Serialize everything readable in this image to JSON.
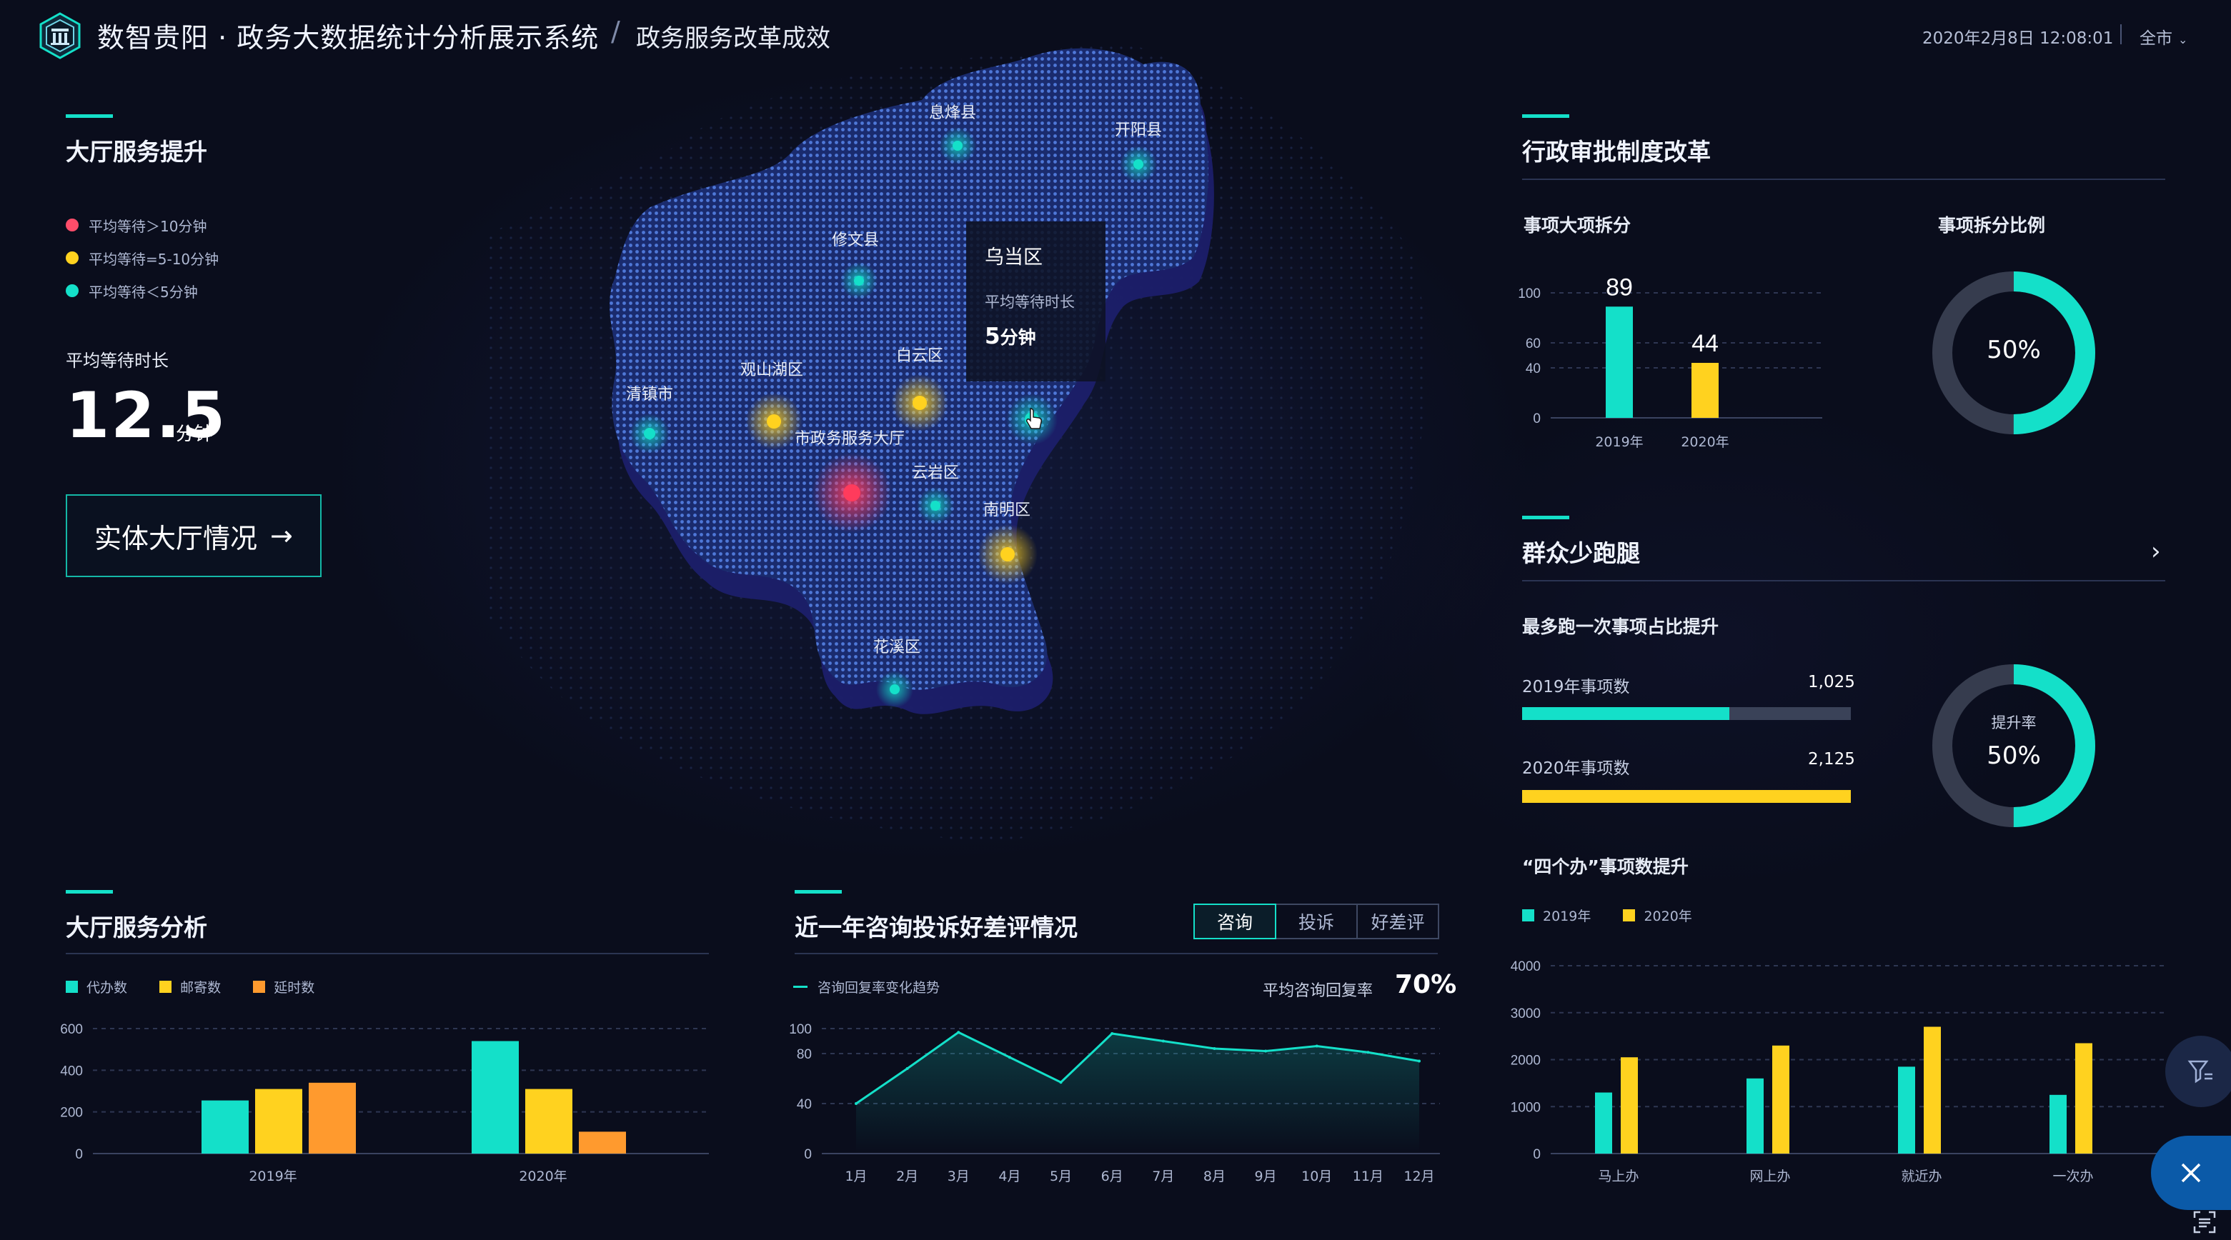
{
  "header": {
    "app_title": "数智贵阳 · 政务大数据统计分析展示系统",
    "separator": "/",
    "page_name": "政务服务改革成效",
    "datetime": "2020年2月8日  12:08:01",
    "city": "全市",
    "logo_icon": "building-shield-icon"
  },
  "hall_service": {
    "title": "大厅服务提升",
    "legend": [
      {
        "label": "平均等待＞10分钟",
        "color": "#ff4d6a"
      },
      {
        "label": "平均等待=5-10分钟",
        "color": "#ffd21f"
      },
      {
        "label": "平均等待＜5分钟",
        "color": "#14e0c9"
      }
    ],
    "avg_wait_label": "平均等待时长",
    "avg_wait_value": "12.5",
    "avg_wait_unit": "分钟",
    "button_label": "实体大厅情况",
    "button_arrow": "→"
  },
  "map": {
    "districts": [
      {
        "name": "息烽县",
        "level": "low"
      },
      {
        "name": "开阳县",
        "level": "low"
      },
      {
        "name": "修文县",
        "level": "low"
      },
      {
        "name": "白云区",
        "level": "mid"
      },
      {
        "name": "观山湖区",
        "level": "mid"
      },
      {
        "name": "清镇市",
        "level": "low"
      },
      {
        "name": "市政务服务大厅",
        "level": "high"
      },
      {
        "name": "云岩区",
        "level": "low"
      },
      {
        "name": "南明区",
        "level": "mid"
      },
      {
        "name": "花溪区",
        "level": "low"
      },
      {
        "name": "乌当区",
        "level": "low"
      }
    ],
    "tooltip": {
      "name": "乌当区",
      "label": "平均等待时长",
      "value": "5",
      "unit": "分钟"
    }
  },
  "admin_reform": {
    "title": "行政审批制度改革",
    "split_title": "事项大项拆分",
    "ratio_title": "事项拆分比例",
    "ratio_value": "50%",
    "ratio_fraction": 0.5,
    "chart_data": {
      "type": "bar",
      "categories": [
        "2019年",
        "2020年"
      ],
      "values": [
        89,
        44
      ],
      "yticks": [
        0,
        40,
        60,
        100
      ],
      "ylim": [
        0,
        100
      ],
      "colors": [
        "#14e0c9",
        "#ffd21f"
      ]
    }
  },
  "less_running": {
    "title": "群众少跑腿",
    "subtitle": "最多跑一次事项占比提升",
    "rows": [
      {
        "label": "2019年事项数",
        "value": "1,025",
        "fraction": 0.63,
        "color": "#14e0c9"
      },
      {
        "label": "2020年事项数",
        "value": "2,125",
        "fraction": 1.0,
        "color": "#ffd21f"
      }
    ],
    "rate_label": "提升率",
    "rate_value": "50%",
    "rate_fraction": 0.5
  },
  "four_bans": {
    "title": "“四个办”事项数提升",
    "legend": [
      {
        "label": "2019年",
        "color": "#14e0c9"
      },
      {
        "label": "2020年",
        "color": "#ffd21f"
      }
    ],
    "chart_data": {
      "type": "bar",
      "categories": [
        "马上办",
        "网上办",
        "就近办",
        "一次办"
      ],
      "series": [
        {
          "name": "2019年",
          "values": [
            1300,
            1600,
            1850,
            1250
          ]
        },
        {
          "name": "2020年",
          "values": [
            2050,
            2300,
            2700,
            2350
          ]
        }
      ],
      "yticks": [
        0,
        1000,
        2000,
        3000,
        4000
      ],
      "ylim": [
        0,
        4000
      ]
    }
  },
  "hall_analysis": {
    "title": "大厅服务分析",
    "legend": [
      {
        "label": "代办数",
        "color": "#14e0c9"
      },
      {
        "label": "邮寄数",
        "color": "#ffd21f"
      },
      {
        "label": "延时数",
        "color": "#ff9a2e"
      }
    ],
    "chart_data": {
      "type": "bar",
      "categories": [
        "2019年",
        "2020年"
      ],
      "series": [
        {
          "name": "代办数",
          "values": [
            255,
            540
          ]
        },
        {
          "name": "邮寄数",
          "values": [
            310,
            310
          ]
        },
        {
          "name": "延时数",
          "values": [
            340,
            105
          ]
        }
      ],
      "yticks": [
        0,
        200,
        400,
        600
      ],
      "ylim": [
        0,
        600
      ]
    }
  },
  "consult": {
    "title": "近一年咨询投诉好差评情况",
    "tabs": [
      {
        "label": "咨询",
        "active": true
      },
      {
        "label": "投诉",
        "active": false
      },
      {
        "label": "好差评",
        "active": false
      }
    ],
    "legend": "咨询回复率变化趋势",
    "rate_label": "平均咨询回复率",
    "rate_value": "70%",
    "chart_data": {
      "type": "line",
      "categories": [
        "1月",
        "2月",
        "3月",
        "4月",
        "5月",
        "6月",
        "7月",
        "8月",
        "9月",
        "10月",
        "11月",
        "12月"
      ],
      "values": [
        40,
        68,
        97,
        77,
        57,
        96,
        90,
        84,
        82,
        86,
        81,
        74
      ],
      "yticks": [
        0,
        40,
        80,
        100
      ],
      "ylim": [
        0,
        100
      ],
      "color": "#14e0c9"
    }
  },
  "floating": {
    "filter_icon": "filter-icon",
    "close_icon": "close-icon",
    "corner_icon": "scan-icon"
  }
}
